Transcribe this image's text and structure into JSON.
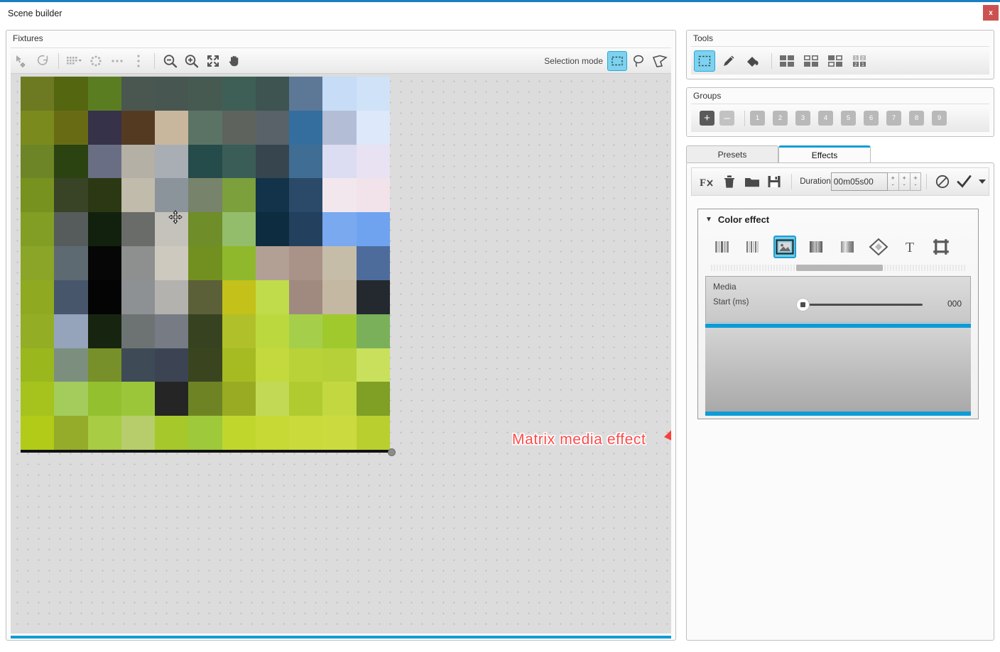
{
  "window": {
    "title": "Scene builder",
    "close_label": "x",
    "accent_color": "#1a7fc1",
    "close_color": "#cc5252"
  },
  "fixtures": {
    "title": "Fixtures",
    "toolbar": [
      {
        "name": "select-move-icon",
        "glyph": "move-select"
      },
      {
        "name": "rotate-icon",
        "glyph": "rotate"
      },
      {
        "name": "grid-layout-icon",
        "glyph": "grid-dropdown"
      },
      {
        "name": "circle-layout-icon",
        "glyph": "circle"
      },
      {
        "name": "line-layout-icon",
        "glyph": "dots-row"
      },
      {
        "name": "column-layout-icon",
        "glyph": "dots-col"
      },
      {
        "name": "zoom-out-icon",
        "glyph": "zoom-out"
      },
      {
        "name": "zoom-in-icon",
        "glyph": "zoom-in"
      },
      {
        "name": "zoom-fit-icon",
        "glyph": "fit"
      },
      {
        "name": "pan-hand-icon",
        "glyph": "hand"
      }
    ],
    "selection_mode_label": "Selection mode",
    "selection_modes": [
      {
        "name": "rectangle-select",
        "active": true
      },
      {
        "name": "lasso-select",
        "active": false
      },
      {
        "name": "polygon-select",
        "active": false
      }
    ]
  },
  "annotation": {
    "text": "Matrix media effect",
    "color": "#ff4a4a"
  },
  "tools": {
    "title": "Tools",
    "buttons": [
      {
        "name": "select-tool",
        "active": true
      },
      {
        "name": "pencil-tool",
        "active": false
      },
      {
        "name": "paint-bucket-tool",
        "active": false
      }
    ],
    "patterns": [
      {
        "name": "pattern-all-filled"
      },
      {
        "name": "pattern-checker"
      },
      {
        "name": "pattern-alternate"
      },
      {
        "name": "pattern-numbered"
      }
    ]
  },
  "groups": {
    "title": "Groups",
    "add_label": "+",
    "remove_label": "–",
    "numbers": [
      "1",
      "2",
      "3",
      "4",
      "5",
      "6",
      "7",
      "8",
      "9"
    ]
  },
  "tabs": [
    {
      "label": "Presets",
      "active": false
    },
    {
      "label": "Effects",
      "active": true
    }
  ],
  "effects_toolbar": {
    "buttons": [
      {
        "name": "add-effect-icon",
        "glyph": "Fx"
      },
      {
        "name": "delete-effect-icon",
        "glyph": "trash"
      },
      {
        "name": "open-folder-icon",
        "glyph": "folder"
      },
      {
        "name": "save-icon",
        "glyph": "floppy"
      }
    ],
    "duration_label": "Duration",
    "duration_value": "00m05s00",
    "spinner_up": "+",
    "spinner_down": "-",
    "cancel_name": "cancel-icon",
    "confirm_name": "confirm-check-icon",
    "dropdown_name": "confirm-dropdown-caret"
  },
  "color_effect": {
    "title": "Color effect",
    "collapsed": false,
    "caret": "▼",
    "effect_icons": [
      {
        "name": "gradient-bars-effect",
        "active": false
      },
      {
        "name": "stripes-effect",
        "active": false
      },
      {
        "name": "matrix-media-effect",
        "active": true
      },
      {
        "name": "soft-bars-effect",
        "active": false
      },
      {
        "name": "blur-bars-effect",
        "active": false
      },
      {
        "name": "diamond-effect",
        "active": false
      },
      {
        "name": "text-effect",
        "active": false
      },
      {
        "name": "frame-effect",
        "active": false
      }
    ],
    "media_label": "Media",
    "start_label": "Start (ms)",
    "start_value": "000",
    "accent_color": "#0f9cd6"
  },
  "matrix_preview": {
    "columns": 11,
    "rows": 11,
    "cells": [
      "#6e7a22",
      "#54660f",
      "#5b7d22",
      "#4a5751",
      "#485652",
      "#465a52",
      "#3e5f55",
      "#3d5450",
      "#5d7897",
      "#c6dcf7",
      "#cfe2f8",
      "#7b8a1d",
      "#696b14",
      "#36324a",
      "#553a22",
      "#c9b79d",
      "#5b7365",
      "#5e635e",
      "#5a6269",
      "#336e9f",
      "#b3bdd5",
      "#dde8fb",
      "#6d8526",
      "#2b4310",
      "#6a6e84",
      "#b4b0a6",
      "#a9adb4",
      "#254c4b",
      "#3a5d57",
      "#37454f",
      "#3f6d94",
      "#dcdcf3",
      "#e8e2f2",
      "#77921f",
      "#394326",
      "#2b3813",
      "#c0bbab",
      "#8b939b",
      "#77836a",
      "#7ba03c",
      "#123349",
      "#2b4a69",
      "#f3e7ee",
      "#f2e3eb",
      "#839e24",
      "#565c5b",
      "#11210d",
      "#696c68",
      "#c4c2bb",
      "#6f8d28",
      "#93bd6b",
      "#0e2c40",
      "#24405f",
      "#7aa9f0",
      "#6fa3ef",
      "#8aa527",
      "#5e6a72",
      "#060606",
      "#8e9090",
      "#cec9bf",
      "#72901f",
      "#8fb82c",
      "#b3a094",
      "#a99287",
      "#c6bda9",
      "#4d6c9c",
      "#8fa921",
      "#47566b",
      "#040404",
      "#8e9193",
      "#b3b2ae",
      "#5b6038",
      "#c3c11a",
      "#c0dc4a",
      "#a08a80",
      "#c4b8a3",
      "#23292e",
      "#93ae25",
      "#95a4bb",
      "#17240f",
      "#6d7273",
      "#777b84",
      "#374220",
      "#b0c02a",
      "#bbd93f",
      "#a5cf4a",
      "#a0c92d",
      "#7bb05a",
      "#9ab71d",
      "#7c8f7e",
      "#78902a",
      "#3f4a57",
      "#3c4453",
      "#3a4520",
      "#a6ba22",
      "#c4d93d",
      "#b9d238",
      "#b6d03a",
      "#c9e05c",
      "#a5c31c",
      "#a3cc5c",
      "#93c02f",
      "#9cc63a",
      "#252525",
      "#6e8424",
      "#99ab23",
      "#c1d955",
      "#b0cb30",
      "#c3d840",
      "#7f9f25",
      "#b2cb18",
      "#94ac2a",
      "#a8cc43",
      "#b7cd6c",
      "#a7c82a",
      "#9dc93a",
      "#c0d62d",
      "#c6d935",
      "#cada3b",
      "#cbdb3f",
      "#b9cf2f"
    ]
  }
}
